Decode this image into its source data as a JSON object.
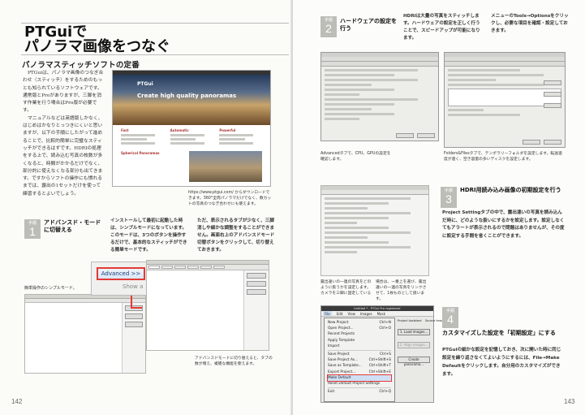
{
  "left": {
    "title_line1": "PTGuiで",
    "title_line2": "パノラマ画像をつなぐ",
    "subheading": "パノラマスティッチソフトの定番",
    "intro_paragraphs": [
      "PTGuiは、パノラマ画像のつなぎ合わせ（スティッチ）をするためのもっとも知られているソフトウェアです。通常版とProがありますが、三脚を消す作業を行う場合はPro版が必要です。",
      "マニュアルなどは英語版しかなく、はじめはかなりとっつきにくいと思いますが、以下の手順にしたがって進めることで、比較的簡単に完璧なスティッチができるはずです。HDRIの処理をする上で、読み込む写真の枚数が多くなると、時間がかかるだけでなく、部分的に使えなくなる部分も出てきます。ですからソフトの操作にも慣れるまでは、露出の1セットだけを使って練習するとよいでしょう。"
    ],
    "website": {
      "logo": "PTGui",
      "hero": "Create high quality panoramas",
      "col1": "Fast",
      "col2": "Automatic",
      "col3": "Powerful",
      "section": "Spherical Panoramas"
    },
    "web_caption": "https://www.ptgui.com/ からダウンロードできます。360°全周パノラマだけでなく、数カットの写真のつなぎ合わせにも使えます。",
    "step1": {
      "label_top": "手順",
      "number": "1",
      "heading": "アドバンスド・モードに切替える",
      "text_a": "インストールして最初に起動した時は、シンプルモードになっています。このモードは、3つのボタンを操作するだけで、基本的なスティッチができる簡単モードです。",
      "text_b": "ただ、表示されるタブが少なく、三脚消しや細かな調整をすることができません。画面右上のアドバンスドモード切替ボタンをクリックして、切り替えておきます。"
    },
    "advanced_button": "Advanced >>",
    "show_text": "Show a",
    "caption_simple": "簡単操作のシンプルモード。",
    "caption_advanced": "アドバンスドモードに切り替えると、タブの数が増え、複雑な機能を使えます。",
    "page_number": "142"
  },
  "right": {
    "step2": {
      "label_top": "手順",
      "number": "2",
      "heading": "ハードウェアの設定を行う",
      "text_a": "HDRIは大量の写真をスティッチします。ハードウェアの設定を正しく行うことで、スピードアップが可能になります。",
      "text_b": "メニューのTools→Optionsをクリックし、必要な項目を確認・設定しておきます。"
    },
    "caption_advanced_tab": "Advancedタブで、CPU、GPUの設定を確認します。",
    "caption_folders": "Folders&Filesタブで、テンポラリーフォルダを設定します。転送速度が速く、空き容量の多いディスクを設定します。",
    "step3": {
      "label_top": "手順",
      "number": "3",
      "heading": "HDRI用読み込み画像の初期設定を行う",
      "text": "Project Settingタブの中で、露出違いの写真を読み込んだ時に、どのような扱いにするかを設定します。設定しなくてもアラートが表示されるので問題はありませんが、その度に設定する手間を省くことができます。"
    },
    "caption_exposure": "露出違いの一連の写真をどのように扱うかを設定します。カメラを三脚に固定している",
    "caption_exposure_b": "場合は、一番上を選び、露出違いの一連の写真をリンクさせて、1枚ものとして扱います。",
    "step4": {
      "label_top": "手順",
      "number": "4",
      "heading": "カスタマイズした設定を「初期設定」にする",
      "text": "PTGuiの細かな設定を記憶しておき、次に開いた時に同じ設定を繰り返さなくてよいようにするには、File→Make Defaultをクリックします。自分用のカスタマイズができます。"
    },
    "menu": {
      "title": "Untitled * - PTGui Pro registered",
      "bar": [
        "File",
        "Edit",
        "View",
        "Images",
        "Mask"
      ],
      "items": [
        {
          "label": "New Project",
          "key": "Ctrl+N"
        },
        {
          "label": "Open Project...",
          "key": "Ctrl+O"
        },
        {
          "label": "Recent Projects",
          "key": ""
        },
        {
          "label": "Apply Template",
          "key": ""
        },
        {
          "label": "Import",
          "key": ""
        },
        {
          "label": "Save Project",
          "key": "Ctrl+S"
        },
        {
          "label": "Save Project As...",
          "key": "Ctrl+Shift+S"
        },
        {
          "label": "Save as Template...",
          "key": "Ctrl+Shift+T"
        },
        {
          "label": "Export Project...",
          "key": "Ctrl+Shift+E"
        },
        {
          "label": "Make Default",
          "key": ""
        },
        {
          "label": "Reset Default Project Settings",
          "key": ""
        },
        {
          "label": "Exit",
          "key": "Ctrl+Q"
        }
      ],
      "btn_load": "1. Load images...",
      "btn_align": "2. Align images...",
      "btn_create": "Create panorama...",
      "tab_assistant": "Project Assistant",
      "tab_source": "Source Images"
    },
    "page_number": "143"
  }
}
